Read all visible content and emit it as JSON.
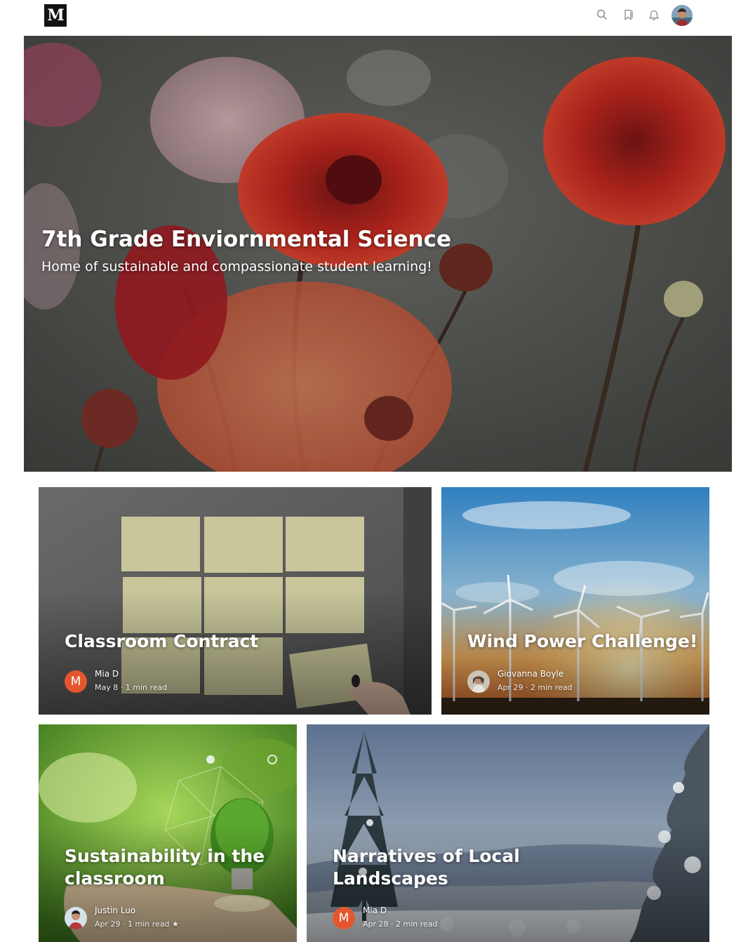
{
  "app": {
    "logo_letter": "M"
  },
  "toolbar": {
    "icons": [
      "search-icon",
      "bookmark-icon",
      "bell-icon",
      "avatar"
    ]
  },
  "hero": {
    "title": "7th Grade Enviornmental Science",
    "subtitle": "Home of sustainable and compassionate student learning!"
  },
  "posts": [
    {
      "title": "Classroom Contract",
      "author": "Mia D",
      "avatar_letter": "M",
      "date": "May 8",
      "read_time": "1 min read",
      "starred": false
    },
    {
      "title": "Wind Power Challenge!",
      "author": "Giovanna Boyle",
      "avatar_letter": "",
      "date": "Apr 29",
      "read_time": "2 min read",
      "starred": false
    },
    {
      "title": "Sustainability in the classroom",
      "author": "Justin Luo",
      "avatar_letter": "",
      "date": "Apr 29",
      "read_time": "1 min read",
      "starred": true,
      "star_glyph": "★"
    },
    {
      "title": "Narratives of Local Landscapes",
      "author": "Mia D",
      "avatar_letter": "M",
      "date": "Apr 28",
      "read_time": "2 min read",
      "starred": false
    }
  ],
  "colors": {
    "logo_bg": "#121212",
    "avatar_orange": "#e4572e"
  },
  "separator": "·"
}
